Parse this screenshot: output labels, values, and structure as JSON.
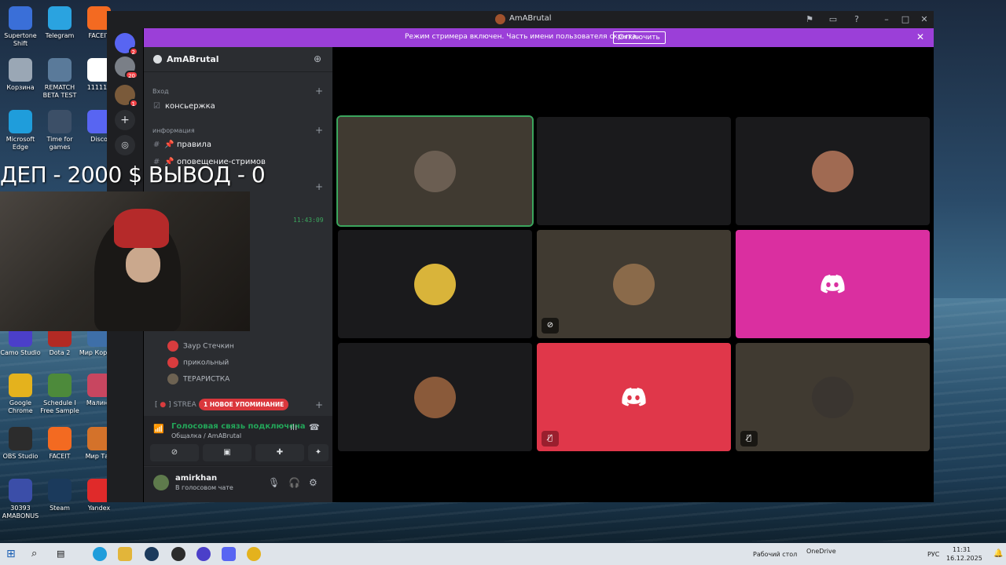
{
  "desktop": {
    "icons": [
      {
        "label": "Supertone Shift",
        "color": "#3a6fd8"
      },
      {
        "label": "Telegram",
        "color": "#2aa3e0"
      },
      {
        "label": "FACEIT",
        "color": "#f36a21"
      },
      {
        "label": "Корзина",
        "color": "#9aa7b5"
      },
      {
        "label": "REMATCH BETA TEST",
        "color": "#5a7a9a"
      },
      {
        "label": "111111",
        "color": "#ffffff"
      },
      {
        "label": "Microsoft Edge",
        "color": "#1f9ddb"
      },
      {
        "label": "Time for games",
        "color": "#3c4f67"
      },
      {
        "label": "Disco",
        "color": "#5865f2"
      },
      {
        "label": "Camo Studio",
        "color": "#4b3fc9"
      },
      {
        "label": "Dota 2",
        "color": "#b32a24"
      },
      {
        "label": "Мир Корабл",
        "color": "#3e6fa8"
      },
      {
        "label": "Google Chrome",
        "color": "#e4b21d"
      },
      {
        "label": "Schedule I Free Sample",
        "color": "#4d8a3b"
      },
      {
        "label": "Малино",
        "color": "#c84660"
      },
      {
        "label": "OBS Studio",
        "color": "#2c2c2c"
      },
      {
        "label": "FACEIT",
        "color": "#f36a21"
      },
      {
        "label": "Мир Тан",
        "color": "#d4722a"
      },
      {
        "label": "30393 AMABONUS",
        "color": "#3b4ea8"
      },
      {
        "label": "Steam",
        "color": "#1b3a5c"
      },
      {
        "label": "Yandex",
        "color": "#e02a2a"
      }
    ]
  },
  "overlay": {
    "text": "ДЕП - 2000 $ ВЫВОД - 0",
    "clock": "11:43:09"
  },
  "discord": {
    "window_title": "AmABrutal",
    "streamer_banner": {
      "message": "Режим стримера включен. Часть имени пользователя скрыта.",
      "button": "Отключить"
    },
    "servers": [
      {
        "badge": "2"
      },
      {
        "badge": "20"
      },
      {
        "badge": "1"
      }
    ],
    "guild": {
      "name": "AmABrutal",
      "categories": [
        {
          "label": "Вход"
        },
        {
          "label": "информация"
        }
      ],
      "channels": [
        {
          "name": "консьержка"
        },
        {
          "name": "📌 правила"
        },
        {
          "name": "📌 оповещение-стримов"
        }
      ],
      "voice_users": [
        {
          "name": "Заур Стечкин",
          "color": "#d83c3e"
        },
        {
          "name": "прикольный",
          "color": "#d83c3e"
        },
        {
          "name": "ТЕРАРИСТКА",
          "color": "#6d6252"
        }
      ],
      "stream_category": "STREA",
      "new_mention": "1 НОВОЕ УПОМИНАНИЕ"
    },
    "voice_panel": {
      "status": "Голосовая связь подключена",
      "channel": "Общалка / AmABrutal"
    },
    "user_panel": {
      "username": "amirkhan",
      "status": "В голосовом чате"
    },
    "tiles": [
      {
        "bg": "#403a31",
        "avatar": "#6b5e52",
        "speaking": true
      },
      {
        "bg": "#1a1a1c",
        "avatar": "",
        "speaking": false
      },
      {
        "bg": "#1a1a1c",
        "avatar": "#a06a52",
        "speaking": false
      },
      {
        "bg": "#1a1a1c",
        "avatar": "#d9b43a",
        "speaking": false
      },
      {
        "bg": "#403a31",
        "avatar": "#8a6a4a",
        "speaking": false
      },
      {
        "bg": "#da2fa0",
        "avatar": "",
        "speaking": false
      },
      {
        "bg": "#1a1a1c",
        "avatar": "#8a5a3a",
        "speaking": false
      },
      {
        "bg": "#e0374a",
        "avatar": "",
        "speaking": false
      },
      {
        "bg": "#403a31",
        "avatar": "#3a3530",
        "speaking": false
      }
    ]
  },
  "taskbar": {
    "desktop_label": "Рабочий стол",
    "onedrive": "OneDrive",
    "lang": "РУС",
    "time": "11:31",
    "date": "16.12.2025"
  }
}
